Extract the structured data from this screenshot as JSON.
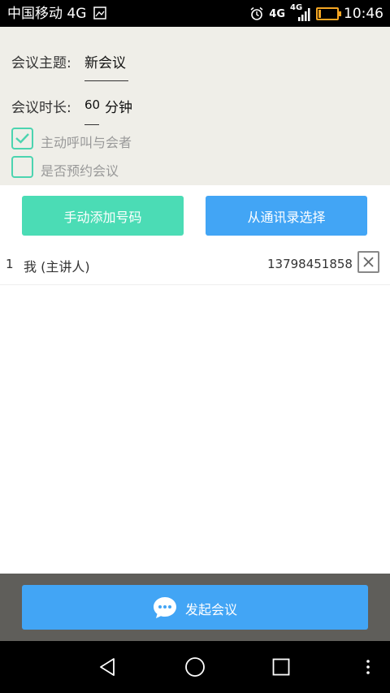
{
  "status_bar": {
    "carrier": "中国移动 4G",
    "network_badge": "4G",
    "signal_badge": "4G",
    "time": "10:46",
    "icons": [
      "image-icon",
      "alarm-icon",
      "signal-icon",
      "battery-icon"
    ]
  },
  "meeting": {
    "topic_label": "会议主题:",
    "topic_value": "新会议",
    "duration_label": "会议时长:",
    "duration_value": "60",
    "duration_unit": "分钟",
    "auto_call_label": "主动呼叫与会者",
    "auto_call_checked": true,
    "schedule_label": "是否预约会议",
    "schedule_checked": false
  },
  "buttons": {
    "manual_add": "手动添加号码",
    "from_contacts": "从通讯录选择",
    "start_meeting": "发起会议"
  },
  "participants": [
    {
      "index": "1",
      "name": "我 (主讲人)",
      "phone": "13798451858"
    }
  ],
  "colors": {
    "accent_green": "#4bdcb5",
    "accent_blue": "#42a5f5",
    "settings_bg": "#efeee8"
  }
}
